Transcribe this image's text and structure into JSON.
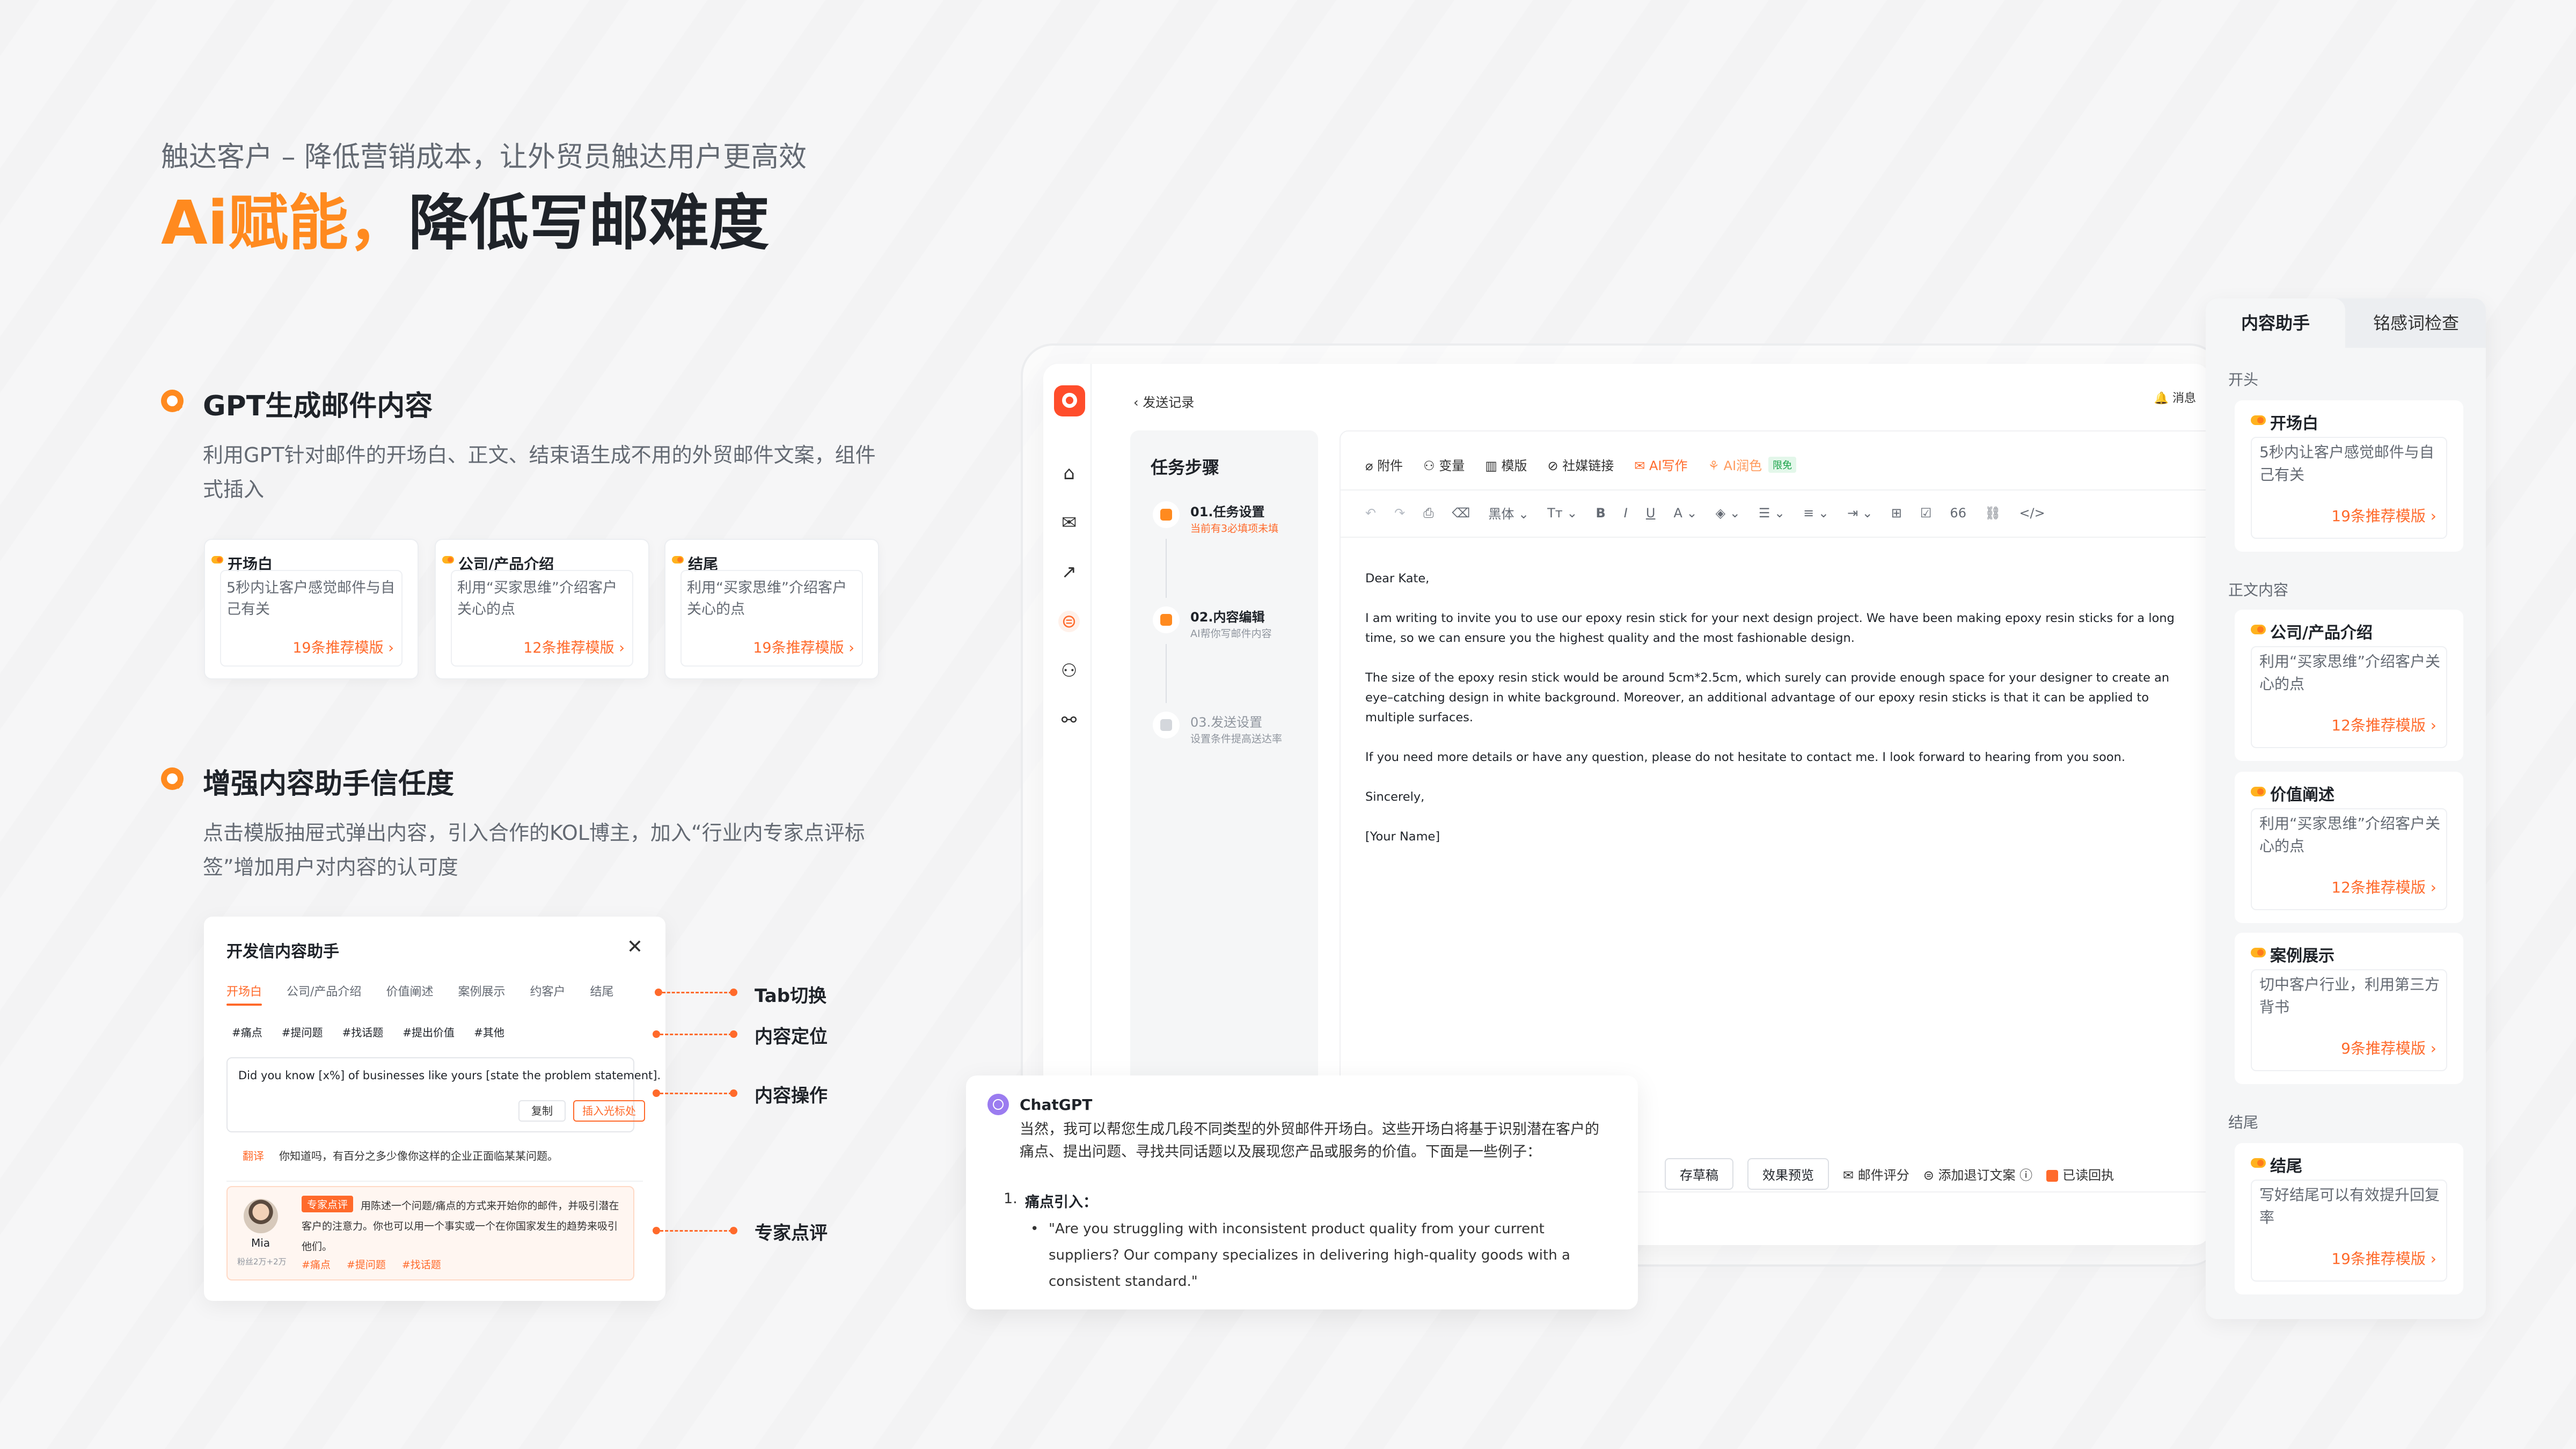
{
  "hero": {
    "subtitle": "触达客户 – 降低营销成本，让外贸员触达用户更高效",
    "headline_accent": "Ai赋能，",
    "headline_main": "降低写邮难度"
  },
  "feature1": {
    "title": "GPT生成邮件内容",
    "desc": "利用GPT针对邮件的开场白、正文、结束语生成不用的外贸邮件文案，组件式插入",
    "cards": [
      {
        "title": "开场白",
        "body": "5秒内让客户感觉邮件与自己有关",
        "link": "19条推荐模版 ›"
      },
      {
        "title": "公司/产品介绍",
        "body": "利用“买家思维”介绍客户关心的点",
        "link": "12条推荐模版 ›"
      },
      {
        "title": "结尾",
        "body": "利用“买家思维”介绍客户关心的点",
        "link": "19条推荐模版 ›"
      }
    ]
  },
  "feature2": {
    "title": "增强内容助手信任度",
    "desc": "点击模版抽屉式弹出内容，引入合作的KOL博主，加入“行业内专家点评标签”增加用户对内容的认可度"
  },
  "popup": {
    "title": "开发信内容助手",
    "close": "✕",
    "tabs": [
      "开场白",
      "公司/产品介绍",
      "价值阐述",
      "案例展示",
      "约客户",
      "结尾"
    ],
    "tags": [
      "#痛点",
      "#提问题",
      "#找话题",
      "#提出价值",
      "#其他"
    ],
    "sample": "Did you know [x%] of businesses like yours [state the problem statement].",
    "copy": "复制",
    "insert": "插入光标处",
    "translate_tag": "翻译",
    "translation": "你知道吗，有百分之多少像你这样的企业正面临某某问题。",
    "expert_badge": "专家点评",
    "expert_text": "用陈述一个问题/痛点的方式来开始你的邮件，并吸引潜在客户的注意力。你也可以用一个事实或一个在你国家发生的趋势来吸引他们。",
    "expert_name": "Mia",
    "expert_fans": "粉丝2万+2万",
    "expert_tags": [
      "#痛点",
      "#提问题",
      "#找话题"
    ]
  },
  "callouts": [
    "Tab切换",
    "内容定位",
    "内容操作",
    "专家点评"
  ],
  "app": {
    "back": "‹  发送记录",
    "message": "🔔 消息",
    "steps_title": "任务步骤",
    "steps": [
      {
        "name": "01.任务设置",
        "sub": "当前有3必填项未填"
      },
      {
        "name": "02.内容编辑",
        "sub": "AI帮你写邮件内容"
      },
      {
        "name": "03.发送设置",
        "sub": "设置条件提高送达率"
      }
    ],
    "toolbar": {
      "attach": "⌀ 附件",
      "variable": "⚇ 变量",
      "template": "▥ 模版",
      "social": "⊘ 社媒链接",
      "ai_write": "✉ AI写作",
      "ai_polish": "⚘ AI润色",
      "limited": "限免"
    },
    "format": {
      "undo": "↶",
      "redo": "↷",
      "print": "⎙",
      "eraser": "⌫",
      "font": "黑体 ⌄",
      "size": "Tт ⌄",
      "bold": "B",
      "italic": "I",
      "underline": "U",
      "color": "A ⌄",
      "highlight": "◈ ⌄",
      "list": "☰ ⌄",
      "align": "≡ ⌄",
      "indent": "⇥ ⌄",
      "table": "⊞",
      "check": "☑",
      "quote": "66",
      "link": "⛓",
      "code": "</>"
    },
    "email": {
      "greeting": "Dear Kate,",
      "p1": "I am writing to invite you to use our epoxy resin stick for your next design project. We have been making epoxy resin sticks for a long time, so we can ensure you the highest quality and the most fashionable design.",
      "p2": "The size of the epoxy resin stick would be around 5cm*2.5cm, which surely can provide enough space for your designer to create an eye–catching design in white background. Moreover, an additional advantage of our epoxy resin sticks is that it can be applied to multiple surfaces.",
      "p3": "If you need more details or have any question, please do not hesitate to contact me. I look forward to hearing from you soon.",
      "closing": "Sincerely,",
      "name": "[Your Name]"
    },
    "bottom": {
      "draft": "存草稿",
      "preview": "效果预览",
      "score": "✉ 邮件评分",
      "unsubscribe": "⊜ 添加退订文案 ⓘ",
      "read": "已读回执"
    }
  },
  "gpt": {
    "name": "ChatGPT",
    "intro": "当然，我可以帮您生成几段不同类型的外贸邮件开场白。这些开场白将基于识别潜在客户的痛点、提出问题、寻找共同话题以及展现您产品或服务的价值。下面是一些例子：",
    "num": "1.",
    "heading": "痛点引入：",
    "bullet": "•",
    "quote": "\"Are you struggling with inconsistent product quality from your current suppliers? Our company specializes in delivering high-quality goods with a consistent standard.\""
  },
  "right_panel": {
    "tab_active": "内容助手",
    "tab_inactive": "铭感词检查",
    "sections": [
      "开头",
      "正文内容",
      "结尾"
    ],
    "cards": [
      {
        "title": "开场白",
        "body": "5秒内让客户感觉邮件与自己有关",
        "link": "19条推荐模版 ›"
      },
      {
        "title": "公司/产品介绍",
        "body": "利用“买家思维”介绍客户关心的点",
        "link": "12条推荐模版 ›"
      },
      {
        "title": "价值阐述",
        "body": "利用“买家思维”介绍客户关心的点",
        "link": "12条推荐模版 ›"
      },
      {
        "title": "案例展示",
        "body": "切中客户行业，利用第三方背书",
        "link": "9条推荐模版 ›"
      },
      {
        "title": "结尾",
        "body": "写好结尾可以有效提升回复率",
        "link": "19条推荐模版 ›"
      }
    ]
  },
  "colors": {
    "accent": "#ff6a2b",
    "accent_orange": "#ff8a1f",
    "text": "#1f2329",
    "muted": "#646a73"
  }
}
